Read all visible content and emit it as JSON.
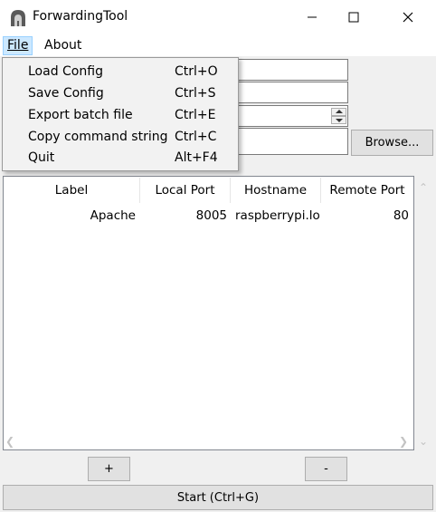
{
  "window": {
    "title": "ForwardingTool",
    "icon": "app-icon",
    "controls": [
      "minimize-icon",
      "maximize-icon",
      "close-icon"
    ]
  },
  "menubar": {
    "file": "File",
    "about": "About"
  },
  "file_menu": {
    "items": [
      {
        "label": "Load Config",
        "shortcut": "Ctrl+O"
      },
      {
        "label": "Save Config",
        "shortcut": "Ctrl+S"
      },
      {
        "label": "Export batch file",
        "shortcut": "Ctrl+E"
      },
      {
        "label": "Copy command string",
        "shortcut": "Ctrl+C"
      },
      {
        "label": "Quit",
        "shortcut": "Alt+F4"
      }
    ]
  },
  "form": {
    "browse_label": "Browse..."
  },
  "table": {
    "columns": [
      "Label",
      "Local Port",
      "Hostname",
      "Remote Port"
    ],
    "rows": [
      {
        "label": "Apache",
        "local_port": "8005",
        "hostname": "raspberrypi.lo",
        "remote_port": "80"
      }
    ]
  },
  "buttons": {
    "add": "+",
    "remove": "-",
    "start": "Start (Ctrl+G)"
  },
  "colors": {
    "menu_highlight": "#cce8ff",
    "menu_bg": "#f2f2f2",
    "window_bg": "#f0f0f0"
  }
}
